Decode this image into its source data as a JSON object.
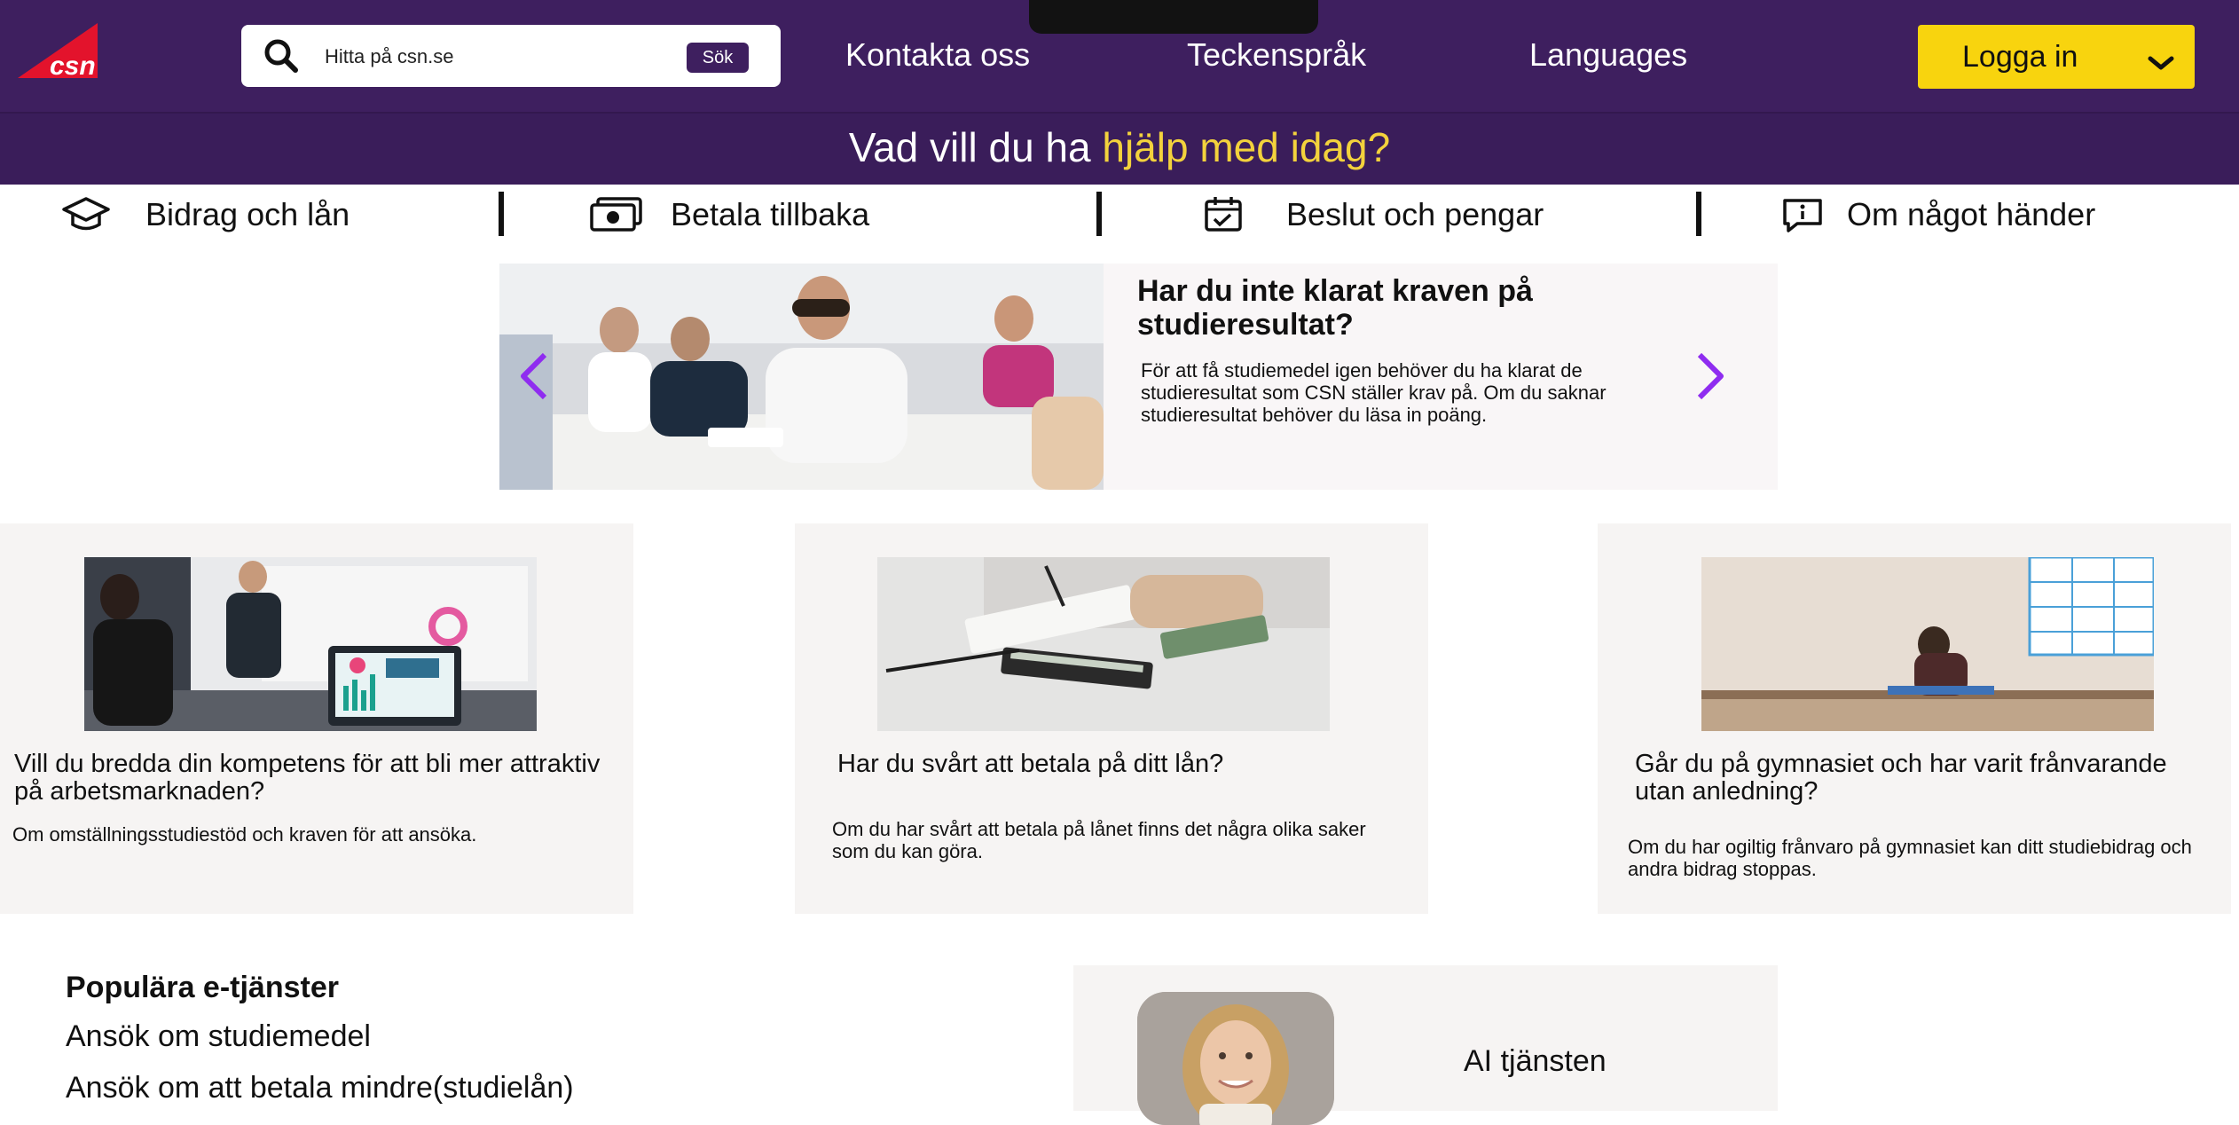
{
  "header": {
    "logo_text": "csn",
    "search": {
      "placeholder": "Hitta på csn.se",
      "button_label": "Sök"
    },
    "nav": [
      "Kontakta oss",
      "Teckenspråk",
      "Languages"
    ],
    "login_label": "Logga in",
    "headline_prefix": "Vad vill du ha ",
    "headline_highlight": "hjälp med idag?"
  },
  "categories": [
    {
      "label": "Bidrag och lån",
      "icon": "graduation-cap-icon"
    },
    {
      "label": "Betala tillbaka",
      "icon": "money-bill-icon"
    },
    {
      "label": "Beslut och pengar",
      "icon": "calendar-check-icon"
    },
    {
      "label": "Om något händer",
      "icon": "info-message-icon"
    }
  ],
  "hero": {
    "title": "Har du inte klarat kraven på studieresultat?",
    "text": "För att få studiemedel igen behöver du ha klarat de studieresultat som CSN ställer krav på. Om du saknar studieresultat behöver du läsa in poäng."
  },
  "cards": [
    {
      "title": "Vill du bredda din kompetens för att bli mer attraktiv på arbetsmarknaden?",
      "text": "Om omställningsstudiestöd och kraven för att ansöka."
    },
    {
      "title": "Har du svårt att betala på ditt lån?",
      "text": "Om du har svårt att betala på lånet finns det några olika saker som du kan göra."
    },
    {
      "title": "Går du på gymnasiet och har varit frånvarande utan anledning?",
      "text": "Om du har ogiltig frånvaro på gymnasiet kan ditt studiebidrag och andra bidrag stoppas."
    }
  ],
  "popular": {
    "title": "Populära e-tjänster",
    "links": [
      "Ansök om studiemedel",
      "Ansök om att betala mindre(studielån)"
    ]
  },
  "ai": {
    "label": "AI tjänsten"
  },
  "colors": {
    "header_bg": "#3e1f5f",
    "accent_yellow": "#f8d40e",
    "headline_highlight": "#f3d23c",
    "arrow_purple": "#8f2cf0",
    "card_bg": "#f6f4f3"
  }
}
